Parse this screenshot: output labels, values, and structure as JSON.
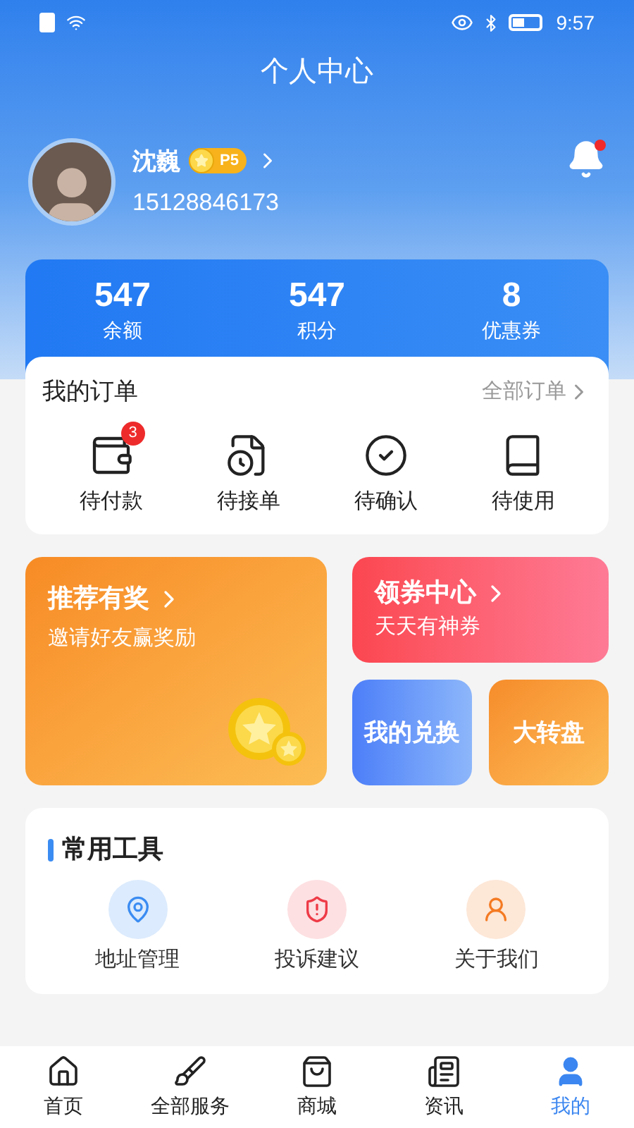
{
  "status_bar": {
    "time": "9:57"
  },
  "title": "个人中心",
  "profile": {
    "name": "沈巍",
    "level": "P5",
    "phone": "15128846173",
    "unread": true
  },
  "stats": [
    {
      "value": "547",
      "label": "余额"
    },
    {
      "value": "547",
      "label": "积分"
    },
    {
      "value": "8",
      "label": "优惠券"
    }
  ],
  "orders": {
    "title": "我的订单",
    "more": "全部订单",
    "items": [
      {
        "label": "待付款",
        "badge": "3"
      },
      {
        "label": "待接单"
      },
      {
        "label": "待确认"
      },
      {
        "label": "待使用"
      }
    ]
  },
  "promos": {
    "referral": {
      "title": "推荐有奖",
      "subtitle": "邀请好友赢奖励"
    },
    "coupons": {
      "title": "领券中心",
      "subtitle": "天天有神券"
    },
    "tiles": [
      {
        "title": "我的兑换",
        "kind": "blue"
      },
      {
        "title": "大转盘",
        "kind": "orange"
      }
    ]
  },
  "tools": {
    "title": "常用工具",
    "items": [
      {
        "label": "地址管理",
        "kind": "address"
      },
      {
        "label": "投诉建议",
        "kind": "complaint"
      },
      {
        "label": "关于我们",
        "kind": "about"
      }
    ]
  },
  "tab_bar": [
    {
      "label": "首页",
      "selected": false
    },
    {
      "label": "全部服务",
      "selected": false
    },
    {
      "label": "商城",
      "selected": false
    },
    {
      "label": "资讯",
      "selected": false
    },
    {
      "label": "我的",
      "selected": true
    }
  ]
}
